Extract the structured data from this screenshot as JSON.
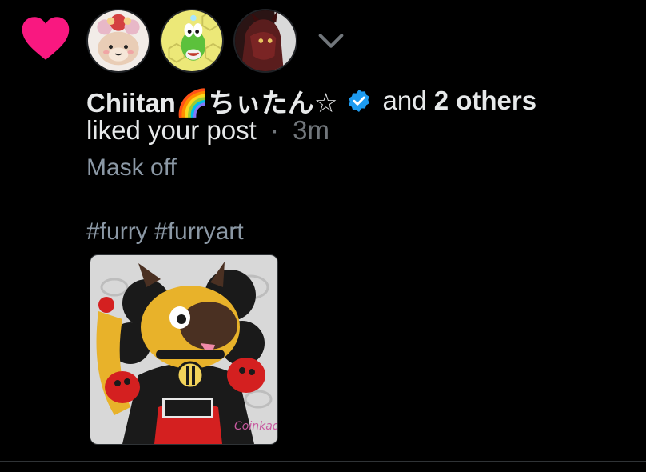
{
  "notification": {
    "type_icon": "heart-icon",
    "type_color": "#f91880",
    "actor_name": "Chiitan🌈ちぃたん☆",
    "verified_icon": "verified-badge-icon",
    "verified_color": "#1d9bf0",
    "connector": "and",
    "others": "2 others",
    "action": "liked your post",
    "separator": "·",
    "time": "3m",
    "expand_icon": "chevron-down-icon"
  },
  "avatars": [
    {
      "name": "avatar-chiitan"
    },
    {
      "name": "avatar-yoshi"
    },
    {
      "name": "avatar-dark-character"
    }
  ],
  "post": {
    "text": "Mask off",
    "hashtags": "#furry #furryart",
    "media_signature": "Coinkado"
  }
}
